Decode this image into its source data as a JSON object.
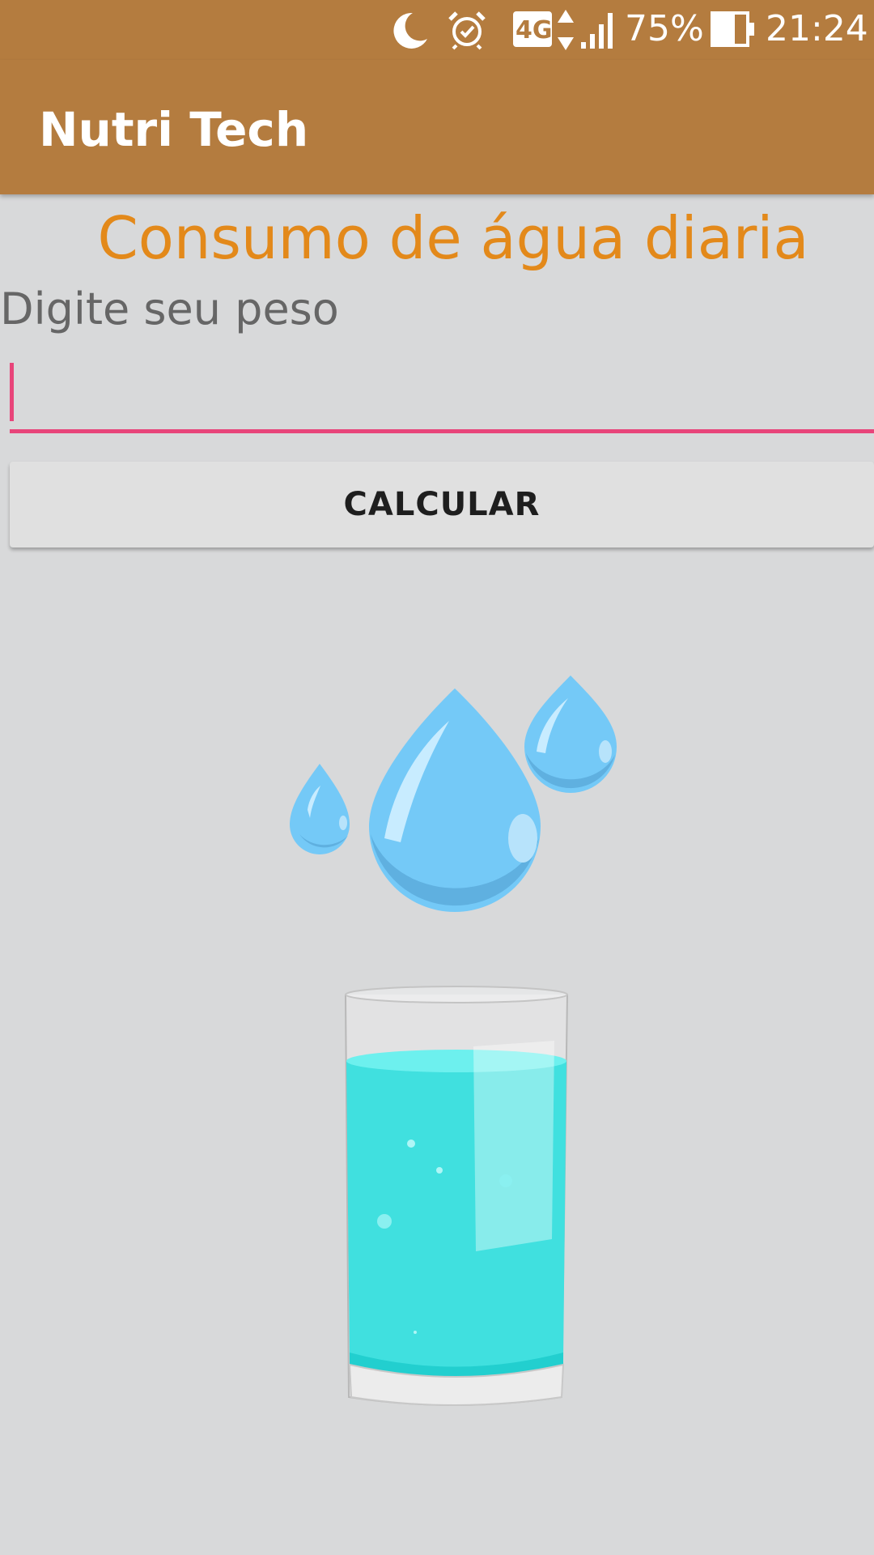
{
  "status_bar": {
    "network": "4G",
    "battery": "75%",
    "time": "21:24",
    "icons": [
      "moon-icon",
      "alarm-icon",
      "network-4g-icon",
      "data-arrows-icon",
      "signal-icon",
      "battery-icon"
    ]
  },
  "app_bar": {
    "title": "Nutri Tech"
  },
  "main": {
    "heading": "Consumo de água diaria",
    "weight_label": "Digite seu peso",
    "weight_input_value": "",
    "calculate_button": "CALCULAR"
  },
  "colors": {
    "app_bar": "#b47c3f",
    "heading": "#e3891a",
    "input_accent": "#e8457a",
    "background": "#d8d9da",
    "water": "#40e0df",
    "drop": "#74c9f7"
  },
  "illustration": {
    "icons": [
      "water-drops-icon",
      "water-glass-icon"
    ]
  }
}
